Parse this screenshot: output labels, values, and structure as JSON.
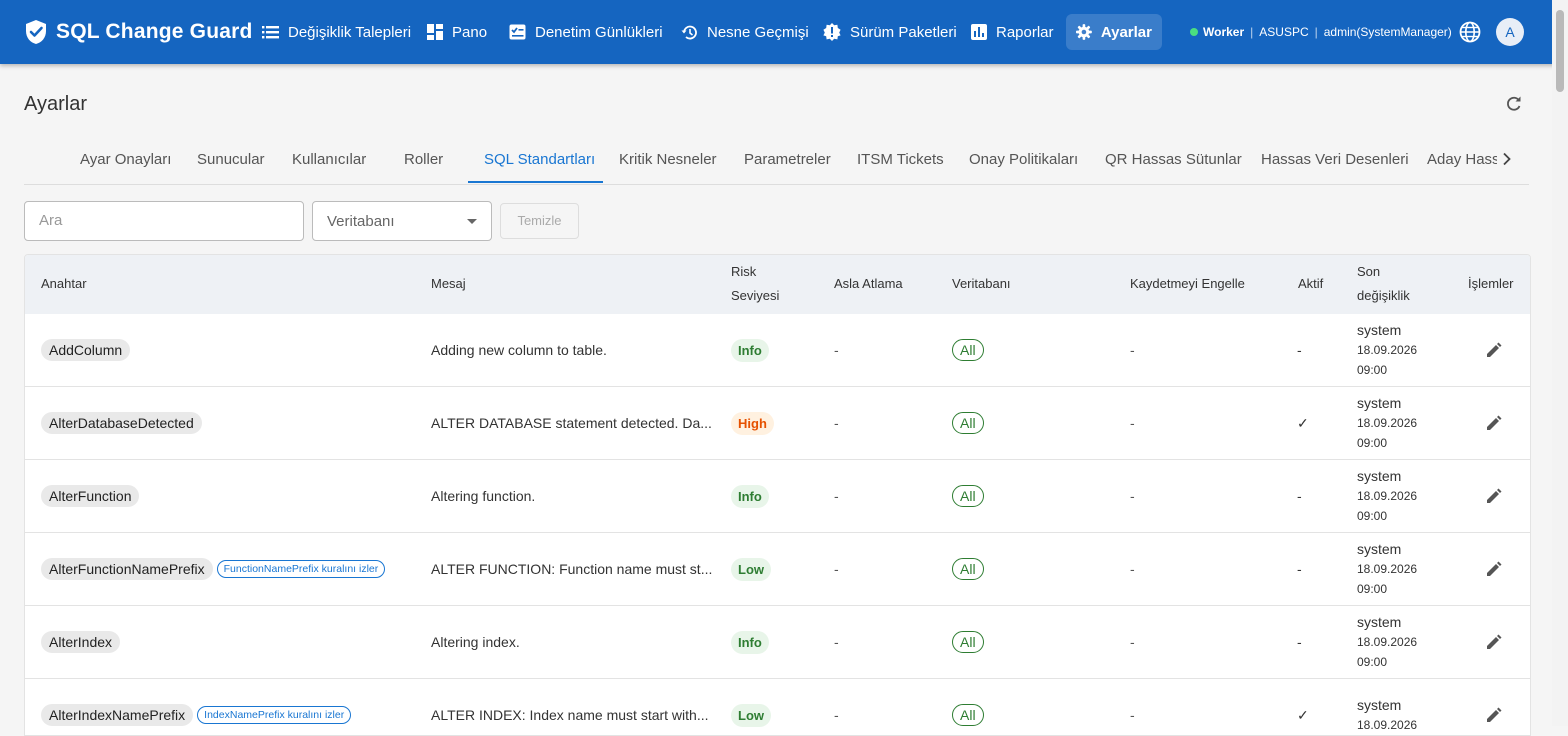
{
  "app": {
    "title": "SQL Change Guard"
  },
  "nav": {
    "items": [
      {
        "label": "Değişiklik Talepleri",
        "icon": "list-icon"
      },
      {
        "label": "Pano",
        "icon": "dashboard-icon"
      },
      {
        "label": "Denetim Günlükleri",
        "icon": "audit-log-icon"
      },
      {
        "label": "Nesne Geçmişi",
        "icon": "history-icon"
      },
      {
        "label": "Sürüm Paketleri",
        "icon": "release-badge-icon"
      },
      {
        "label": "Raporlar",
        "icon": "bar-chart-icon"
      },
      {
        "label": "Ayarlar",
        "icon": "gear-icon",
        "active": true
      }
    ]
  },
  "status": {
    "worker_label": "Worker",
    "host": "ASUSPC",
    "user": "admin(SystemManager)",
    "worker_color": "#4ade80"
  },
  "user": {
    "avatar_initial": "A"
  },
  "page": {
    "title": "Ayarlar"
  },
  "tabs": {
    "items": [
      "Ayar Onayları",
      "Sunucular",
      "Kullanıcılar",
      "Roller",
      "SQL Standartları",
      "Kritik Nesneler",
      "Parametreler",
      "ITSM Tickets",
      "Onay Politikaları",
      "QR Hassas Sütunlar",
      "Hassas Veri Desenleri",
      "Aday Hass"
    ],
    "active": "SQL Standartları"
  },
  "filters": {
    "search_placeholder": "Ara",
    "database_select": "Veritabanı",
    "clear_label": "Temizle"
  },
  "table": {
    "headers": {
      "key": "Anahtar",
      "message": "Mesaj",
      "risk_line1": "Risk",
      "risk_line2": "Seviyesi",
      "never_skip": "Asla Atlama",
      "database": "Veritabanı",
      "block_save": "Kaydetmeyi Engelle",
      "active": "Aktif",
      "last_mod_line1": "Son",
      "last_mod_line2": "değişiklik",
      "actions": "İşlemler"
    },
    "rows": [
      {
        "key": "AddColumn",
        "rule": "",
        "message": "Adding new column to table.",
        "risk": "Info",
        "risk_class": "info",
        "never_skip": "-",
        "database": "All",
        "block_save": "-",
        "active": "-",
        "user": "system",
        "date": "18.09.2026",
        "time": "09:00"
      },
      {
        "key": "AlterDatabaseDetected",
        "rule": "",
        "message": "ALTER DATABASE statement detected. Da...",
        "risk": "High",
        "risk_class": "high",
        "never_skip": "-",
        "database": "All",
        "block_save": "-",
        "active": "✓",
        "user": "system",
        "date": "18.09.2026",
        "time": "09:00"
      },
      {
        "key": "AlterFunction",
        "rule": "",
        "message": "Altering function.",
        "risk": "Info",
        "risk_class": "info",
        "never_skip": "-",
        "database": "All",
        "block_save": "-",
        "active": "-",
        "user": "system",
        "date": "18.09.2026",
        "time": "09:00"
      },
      {
        "key": "AlterFunctionNamePrefix",
        "rule": "FunctionNamePrefix kuralını izler",
        "message": "ALTER FUNCTION: Function name must st...",
        "risk": "Low",
        "risk_class": "low",
        "never_skip": "-",
        "database": "All",
        "block_save": "-",
        "active": "-",
        "user": "system",
        "date": "18.09.2026",
        "time": "09:00"
      },
      {
        "key": "AlterIndex",
        "rule": "",
        "message": "Altering index.",
        "risk": "Info",
        "risk_class": "info",
        "never_skip": "-",
        "database": "All",
        "block_save": "-",
        "active": "-",
        "user": "system",
        "date": "18.09.2026",
        "time": "09:00"
      },
      {
        "key": "AlterIndexNamePrefix",
        "rule": "IndexNamePrefix kuralını izler",
        "message": "ALTER INDEX: Index name must start with...",
        "risk": "Low",
        "risk_class": "low",
        "never_skip": "-",
        "database": "All",
        "block_save": "-",
        "active": "✓",
        "user": "system",
        "date": "18.09.2026",
        "time": ""
      }
    ]
  },
  "colors": {
    "brand": "#1565c0",
    "accent": "#1976d2",
    "risk_low": "#2e7d32",
    "risk_high": "#e65100"
  }
}
